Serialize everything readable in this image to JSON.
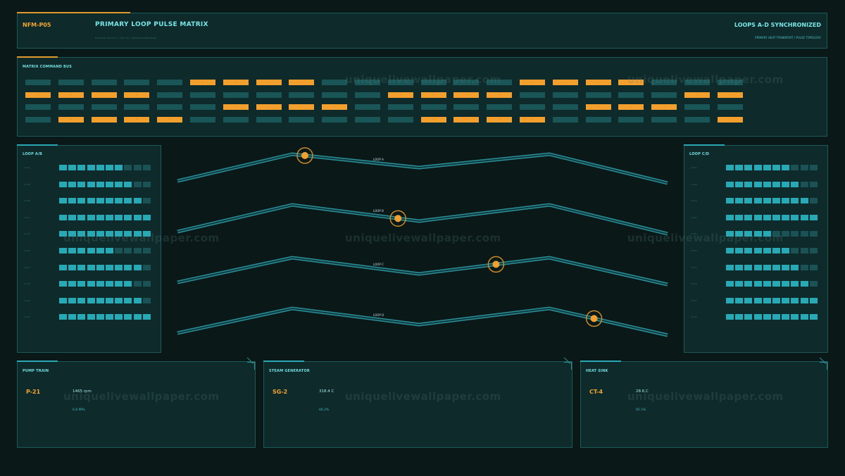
{
  "header": {
    "id": "NFM-P05",
    "title": "PRIMARY LOOP PULSE MATRIX",
    "subtitle": "NUCLEAR FACILITY / UNIT 04 / OPERATOR NETWORK",
    "status": "LOOPS A-D SYNCHRONIZED",
    "status_sub": "PRIMARY HEAT TRANSPORT / PULSE TOPOLOGY"
  },
  "matrix": {
    "title": "MATRIX COMMAND BUS",
    "rows": [
      [
        0,
        0,
        0,
        0,
        0,
        1,
        1,
        1,
        1,
        0,
        0,
        0,
        0,
        0,
        0,
        1,
        1,
        1,
        1,
        0,
        0,
        0
      ],
      [
        1,
        1,
        1,
        1,
        0,
        0,
        0,
        0,
        0,
        0,
        0,
        1,
        1,
        1,
        1,
        0,
        0,
        0,
        0,
        0,
        1,
        1
      ],
      [
        0,
        0,
        0,
        0,
        0,
        0,
        1,
        1,
        1,
        1,
        0,
        0,
        0,
        0,
        0,
        0,
        0,
        1,
        1,
        1,
        0,
        0
      ],
      [
        0,
        1,
        1,
        1,
        1,
        0,
        0,
        0,
        0,
        0,
        0,
        0,
        1,
        1,
        1,
        1,
        0,
        0,
        0,
        0,
        0,
        1
      ]
    ]
  },
  "loop_ab": {
    "title": "LOOP A/B",
    "row_labels": [
      "10.62",
      "10.88",
      "10.86",
      "10.14",
      "10.40",
      "10.26",
      "10.52",
      "10.98",
      "10.24",
      "10.50"
    ],
    "fill": [
      7,
      8,
      9,
      10,
      10,
      6,
      9,
      8,
      9,
      10
    ]
  },
  "loop_cd": {
    "title": "LOOP C/D",
    "row_labels": [
      "10.42",
      "10.68",
      "10.13",
      "10.04",
      "10.60",
      "10.26",
      "10.72",
      "10.18",
      "10.44",
      "10.30"
    ],
    "fill": [
      7,
      8,
      9,
      10,
      5,
      7,
      8,
      9,
      10,
      10
    ]
  },
  "waves": [
    {
      "label": "LOOP A",
      "marker_t": 0.26
    },
    {
      "label": "LOOP B",
      "marker_t": 0.45
    },
    {
      "label": "LOOP C",
      "marker_t": 0.65
    },
    {
      "label": "LOOP D",
      "marker_t": 0.85
    }
  ],
  "bottom": {
    "pump": {
      "title": "PUMP TRAIN",
      "id": "P-21",
      "value": "1465 rpm",
      "sub": "6.8 MPa"
    },
    "steam": {
      "title": "STEAM GENERATOR",
      "id": "SG-2",
      "value": "318.4 C",
      "sub": "84.2%"
    },
    "heat": {
      "title": "HEAT SINK",
      "id": "CT-4",
      "value": "28.6 C",
      "sub": "92.1%"
    }
  },
  "watermark": "uniquelivewallpaper.com",
  "colors": {
    "accent": "#f29f2d",
    "cyan": "#27a9b6",
    "bg": "#0a1918"
  }
}
